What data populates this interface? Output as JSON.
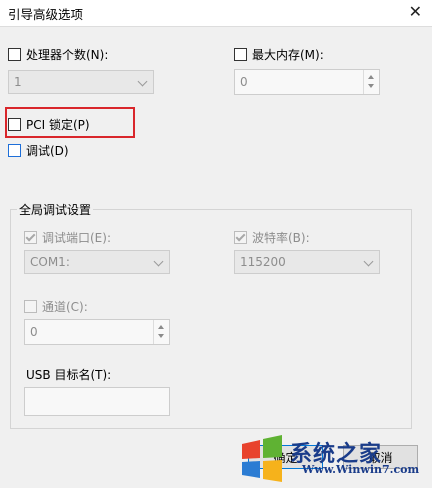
{
  "window": {
    "title": "引导高级选项",
    "close_glyph": "✕"
  },
  "options": {
    "num_processors": {
      "label": "处理器个数(N):",
      "checked": false,
      "value": "1"
    },
    "max_memory": {
      "label": "最大内存(M):",
      "checked": false,
      "value": "0"
    },
    "pci_lock": {
      "label": "PCI 锁定(P)",
      "checked": false
    },
    "debug": {
      "label": "调试(D)",
      "checked": false
    }
  },
  "global_debug": {
    "legend": "全局调试设置",
    "debug_port": {
      "label": "调试端口(E):",
      "checked": true,
      "value": "COM1:"
    },
    "baud_rate": {
      "label": "波特率(B):",
      "checked": true,
      "value": "115200"
    },
    "channel": {
      "label": "通道(C):",
      "checked": false,
      "value": "0"
    },
    "usb_target": {
      "label": "USB 目标名(T):",
      "value": ""
    }
  },
  "buttons": {
    "ok": "确定",
    "cancel": "取消"
  },
  "watermark": {
    "text": "系统之家",
    "url": "Www.Winwin7.com"
  },
  "colors": {
    "highlight": "#d9262b",
    "focus_blue": "#1e6fd9"
  }
}
